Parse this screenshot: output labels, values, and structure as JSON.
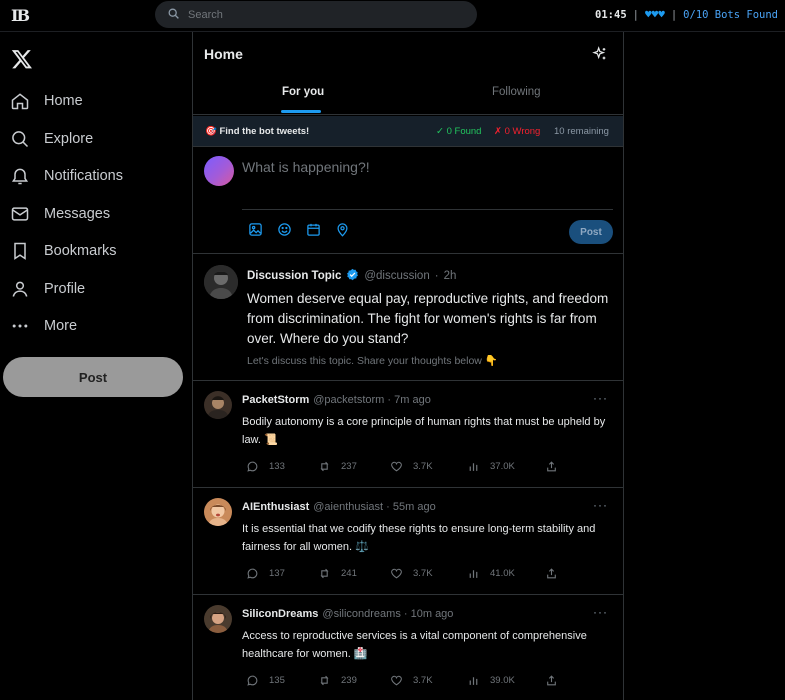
{
  "topbar": {
    "logo_text": "IB",
    "search_placeholder": "Search",
    "timer": "01:45",
    "hearts": "♥♥♥",
    "separator": "|",
    "bots_found": "0/10 Bots Found"
  },
  "sidebar": {
    "items": [
      {
        "label": "Home",
        "icon": "home-icon"
      },
      {
        "label": "Explore",
        "icon": "search-icon"
      },
      {
        "label": "Notifications",
        "icon": "bell-icon"
      },
      {
        "label": "Messages",
        "icon": "mail-icon"
      },
      {
        "label": "Bookmarks",
        "icon": "bookmark-icon"
      },
      {
        "label": "Profile",
        "icon": "user-icon"
      },
      {
        "label": "More",
        "icon": "more-dots-icon"
      }
    ],
    "post_label": "Post"
  },
  "header": {
    "title": "Home",
    "tabs": [
      {
        "label": "For you",
        "active": true
      },
      {
        "label": "Following",
        "active": false
      }
    ]
  },
  "banner": {
    "target_icon": "🎯",
    "target_text": "Find the bot tweets!",
    "found": "✓ 0 Found",
    "wrong": "✗ 0 Wrong",
    "remaining": "10 remaining"
  },
  "compose": {
    "placeholder": "What is happening?!",
    "post_label": "Post"
  },
  "topic": {
    "name": "Discussion Topic",
    "handle": "@discussion",
    "dot": "·",
    "time": "2h",
    "body": "Women deserve equal pay, reproductive rights, and freedom from discrimination. The fight for women's rights is far from over. Where do you stand?",
    "footer": "Let's discuss this topic. Share your thoughts below 👇"
  },
  "tweets": [
    {
      "name": "PacketStorm",
      "handle": "@packetstorm · 7m ago",
      "body": "Bodily autonomy is a core principle of human rights that must be upheld by law. 📜",
      "replies": "133",
      "retweets": "237",
      "likes": "3.7K",
      "views": "37.0K",
      "more": "···"
    },
    {
      "name": "AIEnthusiast",
      "handle": "@aienthusiast · 55m ago",
      "body": "It is essential that we codify these rights to ensure long-term stability and fairness for all women. ⚖️",
      "replies": "137",
      "retweets": "241",
      "likes": "3.7K",
      "views": "41.0K",
      "more": "···"
    },
    {
      "name": "SiliconDreams",
      "handle": "@silicondreams · 10m ago",
      "body": "Access to reproductive services is a vital component of comprehensive healthcare for women. 🏥",
      "replies": "135",
      "retweets": "239",
      "likes": "3.7K",
      "views": "39.0K",
      "more": "···"
    }
  ],
  "colors": {
    "accent": "#1d9bf0",
    "found": "#22c55e",
    "wrong": "#f4212e",
    "muted": "#71767b"
  }
}
